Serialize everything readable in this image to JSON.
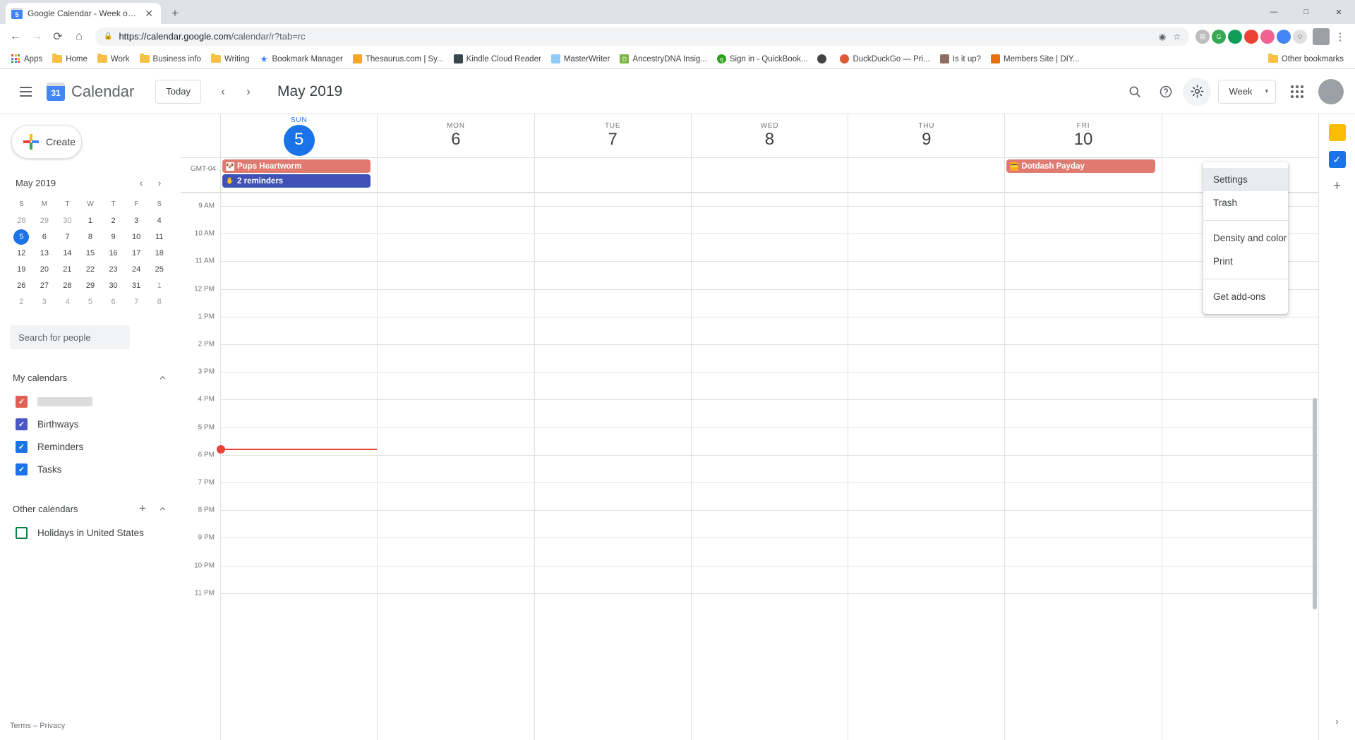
{
  "browser": {
    "tab": {
      "title": "Google Calendar - Week of May",
      "favicon_label": "5",
      "close_label": "✕"
    },
    "new_tab_label": "+",
    "window_controls": {
      "minimize": "—",
      "maximize": "□",
      "close": "✕"
    },
    "nav": {
      "back": "←",
      "forward": "→",
      "reload": "⟳",
      "home": "⌂"
    },
    "omnibox": {
      "lock_icon": "🔒",
      "url_domain": "https://calendar.google.com",
      "url_path": "/calendar/r?tab=rc"
    },
    "bookmarks": [
      {
        "label": "Apps",
        "icon": "apps-grid"
      },
      {
        "label": "Home",
        "icon": "folder"
      },
      {
        "label": "Work",
        "icon": "folder"
      },
      {
        "label": "Business info",
        "icon": "folder"
      },
      {
        "label": "Writing",
        "icon": "folder"
      },
      {
        "label": "Bookmark Manager",
        "icon": "star",
        "color": "#4285f4"
      },
      {
        "label": "Thesaurus.com | Sy...",
        "icon": "site",
        "color": "#f9a825"
      },
      {
        "label": "Kindle Cloud Reader",
        "icon": "site",
        "color": "#37474f"
      },
      {
        "label": "MasterWriter",
        "icon": "site",
        "color": "#90caf9"
      },
      {
        "label": "AncestryDNA Insig...",
        "icon": "site",
        "color": "#7cb342"
      },
      {
        "label": "Sign in - QuickBook...",
        "icon": "site",
        "color": "#2ca01c"
      },
      {
        "label": "",
        "icon": "site",
        "color": "#424242"
      },
      {
        "label": "DuckDuckGo — Pri...",
        "icon": "site",
        "color": "#de5833"
      },
      {
        "label": "Is it up?",
        "icon": "site",
        "color": "#8d6e63"
      },
      {
        "label": "Members Site | DIY...",
        "icon": "site",
        "color": "#e8710a"
      }
    ],
    "other_bookmarks_label": "Other bookmarks",
    "extensions": [
      {
        "name": "eye-icon",
        "color": "#5f6368",
        "glyph": "◉"
      },
      {
        "name": "star-icon",
        "color": "#5f6368",
        "glyph": "☆"
      },
      {
        "name": "extension-note",
        "color": "#9e9e9e",
        "glyph": "▤"
      },
      {
        "name": "extension-green-g",
        "color": "#34a853",
        "glyph": "G"
      },
      {
        "name": "extension-green-dot",
        "color": "#0f9d58",
        "glyph": "●"
      },
      {
        "name": "extension-red",
        "color": "#ea4335",
        "glyph": "●"
      },
      {
        "name": "extension-orange",
        "color": "#f06292",
        "glyph": "●"
      },
      {
        "name": "extension-blue",
        "color": "#4285f4",
        "glyph": "●"
      },
      {
        "name": "extension-grey",
        "color": "#bdc1c6",
        "glyph": "◇"
      }
    ],
    "menu_label": "⋮"
  },
  "calendar": {
    "header": {
      "menu_icon": "hamburger-icon",
      "logo_day": "31",
      "logo_text": "Calendar",
      "today_label": "Today",
      "prev_label": "‹",
      "next_label": "›",
      "period": "May 2019",
      "search_icon": "🔍",
      "help_icon": "?",
      "settings_icon": "⚙",
      "view_label": "Week",
      "view_caret": "▾",
      "apps_icon": "apps-grid-icon"
    },
    "settings_menu": {
      "items": [
        {
          "label": "Settings",
          "selected": true
        },
        {
          "label": "Trash",
          "selected": false
        },
        {
          "separator_after": true
        },
        {
          "label": "Density and color",
          "selected": false
        },
        {
          "label": "Print",
          "selected": false
        },
        {
          "separator_after2": true
        },
        {
          "label": "Get add-ons",
          "selected": false
        }
      ]
    },
    "sidebar": {
      "create_label": "Create",
      "mini_calendar": {
        "title": "May 2019",
        "prev": "‹",
        "next": "›",
        "dow": [
          "S",
          "M",
          "T",
          "W",
          "T",
          "F",
          "S"
        ],
        "weeks": [
          [
            {
              "d": "28",
              "o": true
            },
            {
              "d": "29",
              "o": true
            },
            {
              "d": "30",
              "o": true
            },
            {
              "d": "1"
            },
            {
              "d": "2"
            },
            {
              "d": "3"
            },
            {
              "d": "4"
            }
          ],
          [
            {
              "d": "5",
              "today": true
            },
            {
              "d": "6"
            },
            {
              "d": "7"
            },
            {
              "d": "8"
            },
            {
              "d": "9"
            },
            {
              "d": "10"
            },
            {
              "d": "11"
            }
          ],
          [
            {
              "d": "12"
            },
            {
              "d": "13"
            },
            {
              "d": "14"
            },
            {
              "d": "15"
            },
            {
              "d": "16"
            },
            {
              "d": "17"
            },
            {
              "d": "18"
            }
          ],
          [
            {
              "d": "19"
            },
            {
              "d": "20"
            },
            {
              "d": "21"
            },
            {
              "d": "22"
            },
            {
              "d": "23"
            },
            {
              "d": "24"
            },
            {
              "d": "25"
            }
          ],
          [
            {
              "d": "26"
            },
            {
              "d": "27"
            },
            {
              "d": "28"
            },
            {
              "d": "29"
            },
            {
              "d": "30"
            },
            {
              "d": "31"
            },
            {
              "d": "1",
              "o": true
            }
          ],
          [
            {
              "d": "2",
              "o": true
            },
            {
              "d": "3",
              "o": true
            },
            {
              "d": "4",
              "o": true
            },
            {
              "d": "5",
              "o": true
            },
            {
              "d": "6",
              "o": true
            },
            {
              "d": "7",
              "o": true
            },
            {
              "d": "8",
              "o": true
            }
          ]
        ]
      },
      "search_people_placeholder": "Search for people",
      "my_calendars": {
        "title": "My calendars",
        "collapse_icon": "^",
        "items": [
          {
            "label": "",
            "redacted": true,
            "checked": true,
            "color": "#e06055"
          },
          {
            "label": "Birthways",
            "checked": true,
            "color": "#4b57c4"
          },
          {
            "label": "Reminders",
            "checked": true,
            "color": "#1a73e8"
          },
          {
            "label": "Tasks",
            "checked": true,
            "color": "#1a73e8"
          }
        ]
      },
      "other_calendars": {
        "title": "Other calendars",
        "add_icon": "+",
        "collapse_icon": "^",
        "items": [
          {
            "label": "Holidays in United States",
            "checked": false,
            "color": "#0b8043"
          }
        ]
      },
      "footer": {
        "terms": "Terms",
        "separator": "–",
        "privacy": "Privacy"
      }
    },
    "grid": {
      "timezone_label": "GMT-04",
      "days": [
        {
          "dow": "SUN",
          "num": "5",
          "today": true
        },
        {
          "dow": "MON",
          "num": "6",
          "today": false
        },
        {
          "dow": "TUE",
          "num": "7",
          "today": false
        },
        {
          "dow": "WED",
          "num": "8",
          "today": false
        },
        {
          "dow": "THU",
          "num": "9",
          "today": false
        },
        {
          "dow": "FRI",
          "num": "10",
          "today": false
        },
        {
          "dow": "",
          "num": "",
          "today": false
        }
      ],
      "allday_events": [
        {
          "day": 0,
          "title": "Pups Heartworm",
          "color": "#e07a70",
          "icon": "dog-icon",
          "icon_bg": "#ffffff"
        },
        {
          "day": 0,
          "title": "2 reminders",
          "color": "#3f51b5",
          "icon": "reminder-icon",
          "icon_bg": "#3f51b5"
        },
        {
          "day": 5,
          "title": "Dotdash Payday",
          "color": "#e07a70",
          "icon": "money-icon",
          "icon_bg": "#f9a825"
        }
      ],
      "hours": [
        "9 AM",
        "10 AM",
        "11 AM",
        "12 PM",
        "1 PM",
        "2 PM",
        "3 PM",
        "4 PM",
        "5 PM",
        "6 PM",
        "7 PM",
        "8 PM",
        "9 PM",
        "10 PM",
        "11 PM"
      ],
      "current_time_indicator": {
        "color": "#ea4335",
        "day": 0
      }
    },
    "right_rail": {
      "icons": [
        {
          "name": "keep-icon",
          "glyph": "●",
          "color": "#fbbc04"
        },
        {
          "name": "tasks-icon",
          "glyph": "✓",
          "color": "#1a73e8"
        },
        {
          "name": "add-addon-icon",
          "glyph": "+",
          "color": "#5f6368"
        }
      ],
      "expand_icon": "›"
    }
  }
}
